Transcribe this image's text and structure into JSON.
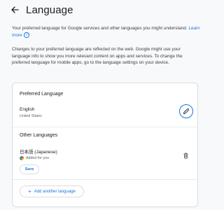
{
  "header": {
    "title": "Language"
  },
  "intro": {
    "text": "Your preferred language for Google services and other languages you might understand.",
    "learn_more": "Learn more"
  },
  "changes_text": "Changes to your preferred language are reflected on the web. Google might use your language info to show you more relevant content on apps and services. To change the preferred language for mobile apps, go to the language settings on your device.",
  "preferred": {
    "title": "Preferred Language",
    "language": "English",
    "region": "United States"
  },
  "other": {
    "title": "Other Languages",
    "language": "日本語 (Japanese)",
    "added_text": "Added for you",
    "save_label": "Save",
    "add_label": "Add another language"
  },
  "colors": {
    "accent": "#1a73e8",
    "background": "#f8f9fa",
    "card": "#ffffff",
    "border": "#dadce0"
  },
  "icons": {
    "back": "back-arrow-icon",
    "edit": "pencil-icon",
    "delete": "trash-icon",
    "help": "help-icon",
    "add": "plus-icon",
    "added": "google-icon"
  }
}
